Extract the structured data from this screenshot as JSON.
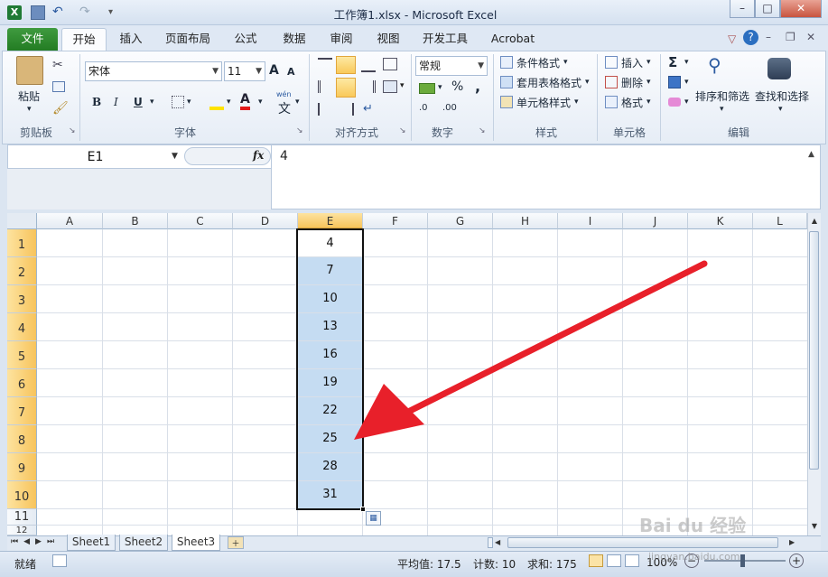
{
  "window": {
    "title": "工作簿1.xlsx - Microsoft Excel",
    "minimize": "–",
    "maximize": "□",
    "close": "✕"
  },
  "tabs": [
    "文件",
    "开始",
    "插入",
    "页面布局",
    "公式",
    "数据",
    "审阅",
    "视图",
    "开发工具",
    "Acrobat"
  ],
  "ribbon": {
    "clipboard": {
      "paste": "粘贴",
      "group": "剪贴板"
    },
    "font": {
      "name": "宋体",
      "size": "11",
      "bold": "B",
      "italic": "I",
      "underline": "U",
      "font_color_glyph": "A",
      "pinyin_glyph": "wén",
      "pinyin_char": "文",
      "grow": "A",
      "shrink": "A",
      "group": "字体"
    },
    "align": {
      "group": "对齐方式"
    },
    "number": {
      "format": "常规",
      "percent": "%",
      "comma": ",",
      "inc_dec": ".0",
      "inc_dec2": ".00",
      "group": "数字"
    },
    "styles": {
      "cond": "条件格式",
      "table": "套用表格格式",
      "cell": "单元格样式",
      "group": "样式"
    },
    "cells": {
      "insert": "插入",
      "delete": "删除",
      "format": "格式",
      "group": "单元格"
    },
    "editing": {
      "sigma": "Σ",
      "sort": "排序和筛选",
      "find": "查找和选择",
      "group": "编辑"
    }
  },
  "formula_bar": {
    "name_box": "E1",
    "fx": "fx",
    "value": "4"
  },
  "columns": [
    "A",
    "B",
    "C",
    "D",
    "E",
    "F",
    "G",
    "H",
    "I",
    "J",
    "K",
    "L"
  ],
  "rows": [
    "1",
    "2",
    "3",
    "4",
    "5",
    "6",
    "7",
    "8",
    "9",
    "10",
    "11",
    "12"
  ],
  "column_e_values": [
    "4",
    "7",
    "10",
    "13",
    "16",
    "19",
    "22",
    "25",
    "28",
    "31"
  ],
  "sheets": [
    "Sheet1",
    "Sheet2",
    "Sheet3"
  ],
  "status": {
    "ready": "就绪",
    "average": "平均值: 17.5",
    "count": "计数: 10",
    "sum": "求和: 175",
    "zoom": "100%"
  },
  "watermark": {
    "brand": "Bai du 经验",
    "url": "jingyan.baidu.com"
  }
}
